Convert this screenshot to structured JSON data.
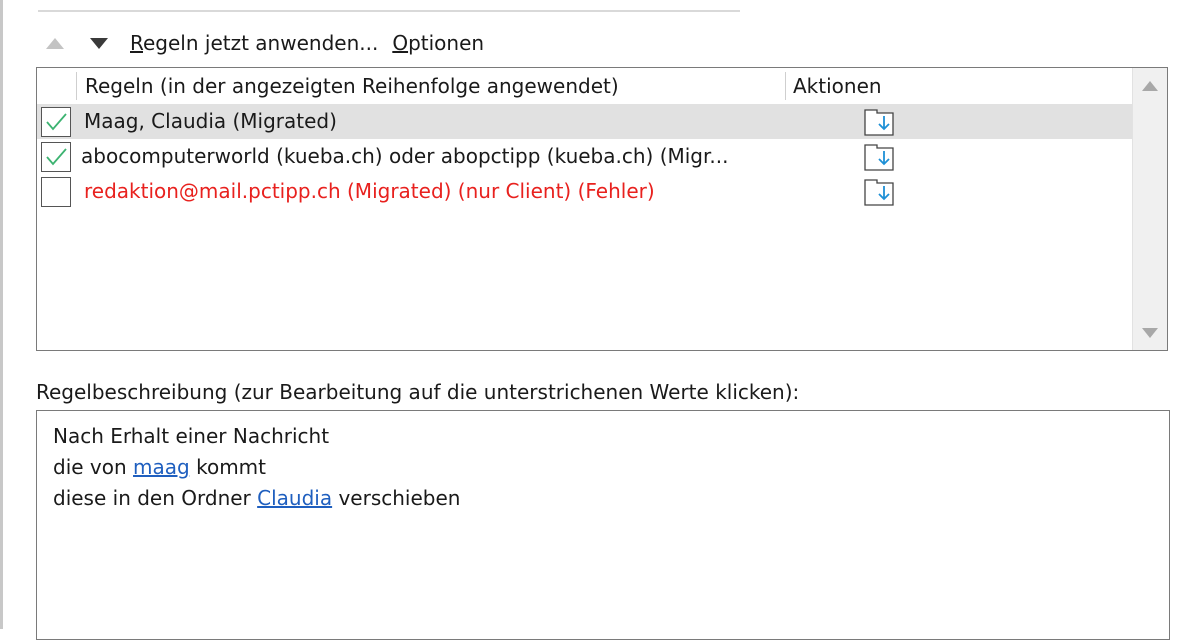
{
  "toolbar": {
    "move_up_icon": "triangle-up-icon",
    "move_down_icon": "triangle-down-icon",
    "apply_now_accesskey": "R",
    "apply_now_rest": "egeln jetzt anwenden...",
    "options_accesskey": "O",
    "options_rest": "ptionen"
  },
  "rules_list": {
    "col_rules": "Regeln (in der angezeigten Reihenfolge angewendet)",
    "col_actions": "Aktionen",
    "rows": [
      {
        "name": "Maag, Claudia (Migrated)",
        "checked": true,
        "selected": true,
        "status": "normal",
        "action_icon": "move-to-folder-icon"
      },
      {
        "name": "abocomputerworld (kueba.ch) oder abopctipp (kueba.ch) (Migr...",
        "checked": true,
        "selected": false,
        "status": "normal",
        "action_icon": "move-to-folder-icon"
      },
      {
        "name": "redaktion@mail.pctipp.ch (Migrated)  (nur Client)  (Fehler)",
        "checked": false,
        "selected": false,
        "status": "error",
        "action_icon": "move-to-folder-icon"
      }
    ]
  },
  "description": {
    "label": "Regelbeschreibung (zur Bearbeitung auf die unterstrichenen Werte klicken):",
    "line1": "Nach Erhalt einer Nachricht",
    "line2_prefix": "die von ",
    "line2_link": "maag",
    "line2_suffix": " kommt",
    "line3_prefix": "diese in den Ordner ",
    "line3_link": "Claudia",
    "line3_suffix": " verschieben"
  },
  "colors": {
    "error_text": "#e8211e",
    "link": "#1f5fbf",
    "selected_row": "#e1e1e1",
    "check_green": "#3cb371",
    "action_icon_blue": "#1e90d6"
  }
}
